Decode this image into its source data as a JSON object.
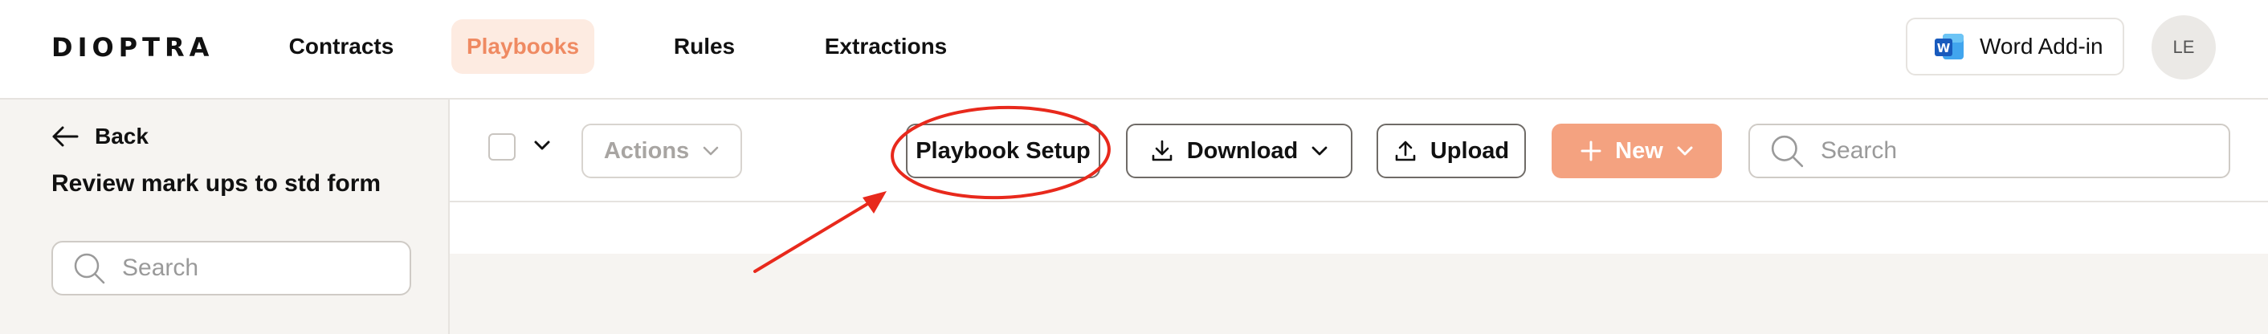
{
  "brand": {
    "logo": "DIOPTRA"
  },
  "nav": {
    "items": [
      {
        "label": "Contracts",
        "active": false
      },
      {
        "label": "Playbooks",
        "active": true
      },
      {
        "label": "Rules",
        "active": false
      },
      {
        "label": "Extractions",
        "active": false
      }
    ]
  },
  "header": {
    "addin_label": "Word Add-in",
    "avatar_initials": "LE"
  },
  "sidebar": {
    "back_label": "Back",
    "title": "Review mark ups to std form",
    "search_placeholder": "Search"
  },
  "toolbar": {
    "actions_label": "Actions",
    "playbook_setup_label": "Playbook Setup",
    "download_label": "Download",
    "upload_label": "Upload",
    "new_label": "New",
    "search_placeholder": "Search"
  },
  "colors": {
    "accent": "#ef8a62",
    "nav_active_bg": "#fdebe1",
    "primary_button": "#f4a280",
    "annotation": "#e8291c"
  },
  "icons": [
    "word-icon",
    "arrow-left-icon",
    "search-icon",
    "chevron-down-icon",
    "download-icon",
    "upload-icon",
    "plus-icon"
  ]
}
